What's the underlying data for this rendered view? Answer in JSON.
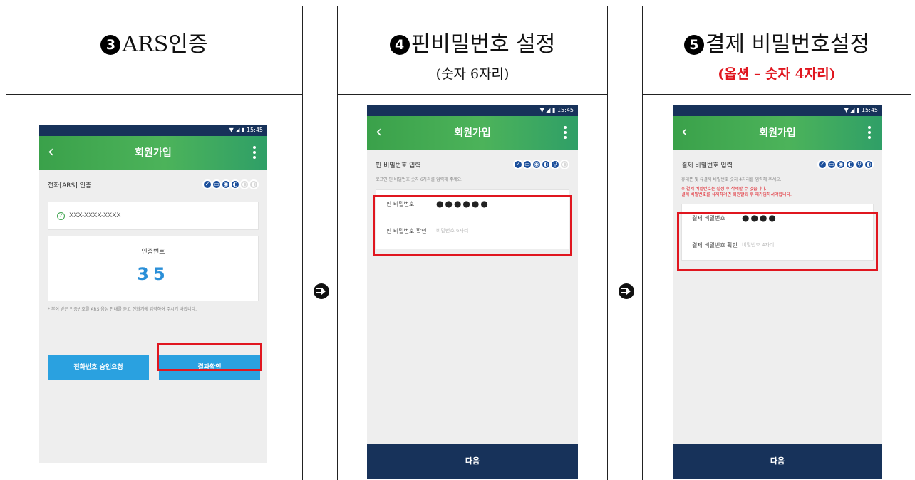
{
  "panel1": {
    "step_num": "3",
    "title": "ARS인증"
  },
  "panel2": {
    "step_num": "4",
    "title": "핀비밀번호 설정",
    "subtitle": "(숫자 6자리)"
  },
  "panel3": {
    "step_num": "5",
    "title": "결제 비밀번호설정",
    "subtitle": "(옵션 – 숫자 4자리)",
    "subtitle_color": "#e0161f"
  },
  "status_time": "15:45",
  "app_title": "회원가입",
  "screen1": {
    "row_label": "전화[ARS] 인증",
    "phone_value": "XXX-XXXX-XXXX",
    "code_label": "인증번호",
    "code_value": "35",
    "note": "* 부여 받은 인증번호를 ARS 음성 안내를 듣고 전화기에 입력하여 주시기 바랍니다.",
    "btn_request": "전화번호 승인요청",
    "btn_confirm": "결과확인"
  },
  "screen2": {
    "row_label": "핀 비밀번호 입력",
    "desc": "로그인 핀 비밀번호 숫자 6자리를 입력해 주세요.",
    "field1_label": "핀 비밀번호",
    "field1_value": "●●●●●●",
    "field2_label": "핀 비밀번호 확인",
    "field2_placeholder": "비밀번호 6자리",
    "next": "다음"
  },
  "screen3": {
    "row_label": "결제 비밀번호 입력",
    "desc": "휴대폰 및 유결제 비밀번호 숫자 4자리를 입력해 주세요.",
    "warn1": "※ 결제 비밀번호는 설정 후 삭제할 수 없습니다.",
    "warn2": "결제 비밀번호를 삭제하려면 회원탈퇴 후 재가입하셔야합니다.",
    "field1_label": "결제 비밀번호",
    "field1_value": "●●●●",
    "field2_label": "결제 비밀번호 확인",
    "field2_placeholder": "비밀번호 4자리",
    "next": "다음"
  },
  "colors": {
    "accent_red": "#e0161f",
    "navy": "#17325a",
    "green": "#3aa14a",
    "blue_button": "#2aa1e0"
  }
}
